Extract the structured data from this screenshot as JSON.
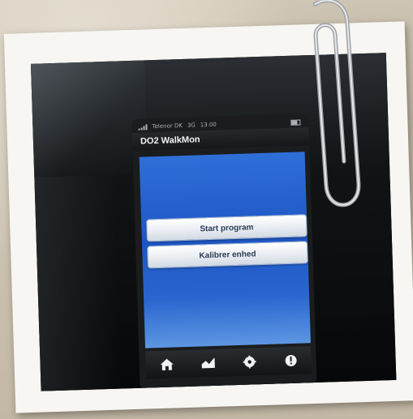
{
  "status_bar": {
    "carrier": "Telenor DK",
    "network": "3G",
    "time": "13.00"
  },
  "app": {
    "title": "DO2 WalkMon"
  },
  "buttons": {
    "start": "Start program",
    "calibrate": "Kalibrer enhed"
  },
  "tabbar": {
    "items": [
      {
        "icon": "home-icon"
      },
      {
        "icon": "graph-icon"
      },
      {
        "icon": "settings-icon"
      },
      {
        "icon": "info-icon"
      }
    ]
  },
  "colors": {
    "screen_blue": "#1d56c4",
    "button_text": "#2a3a55"
  }
}
